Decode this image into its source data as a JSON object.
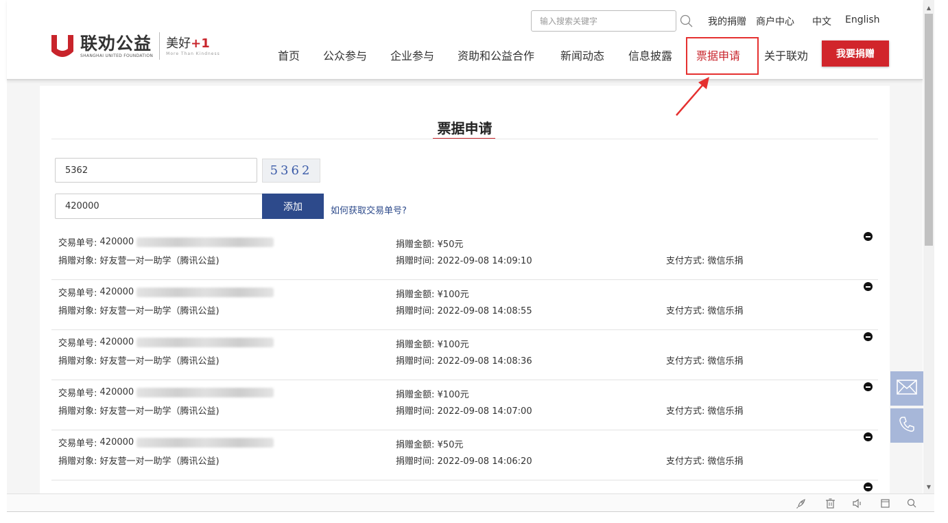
{
  "header": {
    "logo_cn": "联劝公益",
    "logo_en": "SHANGHAI UNITED FOUNDATION",
    "slogan_cn": "美好",
    "slogan_plus": "+1",
    "slogan_en": "More Than Kindness",
    "search_placeholder": "输入搜索关键字",
    "top_links": {
      "my_donations": "我的捐赠",
      "merchant_center": "商户中心",
      "lang_cn": "中文",
      "lang_en": "English"
    },
    "nav": [
      {
        "label": "首页"
      },
      {
        "label": "公众参与"
      },
      {
        "label": "企业参与"
      },
      {
        "label": "资助和公益合作"
      },
      {
        "label": "新闻动态"
      },
      {
        "label": "信息披露"
      },
      {
        "label": "票据申请"
      },
      {
        "label": "关于联劝"
      }
    ],
    "donate_button": "我要捐赠"
  },
  "main": {
    "title": "票据申请",
    "captcha_value": "5362",
    "captcha_image_text": "5362",
    "order_value": "420000",
    "add_button": "添加",
    "help_link": "如何获取交易单号?",
    "records": [
      {
        "id_label": "交易单号:",
        "id_prefix": "420000",
        "target_label": "捐赠对象:",
        "target": "好友营一对一助学（腾讯公益)",
        "amount_label": "捐赠金额:",
        "amount": "¥50元",
        "time_label": "捐赠时间:",
        "time": "2022-09-08 14:09:10",
        "pay_label": "支付方式:",
        "pay": "微信乐捐"
      },
      {
        "id_label": "交易单号:",
        "id_prefix": "420000",
        "target_label": "捐赠对象:",
        "target": "好友营一对一助学（腾讯公益)",
        "amount_label": "捐赠金额:",
        "amount": "¥100元",
        "time_label": "捐赠时间:",
        "time": "2022-09-08 14:08:55",
        "pay_label": "支付方式:",
        "pay": "微信乐捐"
      },
      {
        "id_label": "交易单号:",
        "id_prefix": "420000",
        "target_label": "捐赠对象:",
        "target": "好友营一对一助学（腾讯公益)",
        "amount_label": "捐赠金额:",
        "amount": "¥100元",
        "time_label": "捐赠时间:",
        "time": "2022-09-08 14:08:36",
        "pay_label": "支付方式:",
        "pay": "微信乐捐"
      },
      {
        "id_label": "交易单号:",
        "id_prefix": "420000",
        "target_label": "捐赠对象:",
        "target": "好友营一对一助学（腾讯公益)",
        "amount_label": "捐赠金额:",
        "amount": "¥100元",
        "time_label": "捐赠时间:",
        "time": "2022-09-08 14:07:00",
        "pay_label": "支付方式:",
        "pay": "微信乐捐"
      },
      {
        "id_label": "交易单号:",
        "id_prefix": "420000",
        "target_label": "捐赠对象:",
        "target": "好友营一对一助学（腾讯公益)",
        "amount_label": "捐赠金额:",
        "amount": "¥50元",
        "time_label": "捐赠时间:",
        "time": "2022-09-08 14:06:20",
        "pay_label": "支付方式:",
        "pay": "微信乐捐"
      }
    ]
  },
  "side_buttons": {
    "mail_icon": "mail-icon",
    "phone_icon": "phone-icon"
  },
  "toolbar_icons": [
    "rocket-icon",
    "trash-icon",
    "speaker-icon",
    "window-icon",
    "search-icon"
  ],
  "colors": {
    "brand_red": "#c8242b",
    "accent_blue": "#2d4a8b",
    "annotation_red": "#e5302f"
  }
}
